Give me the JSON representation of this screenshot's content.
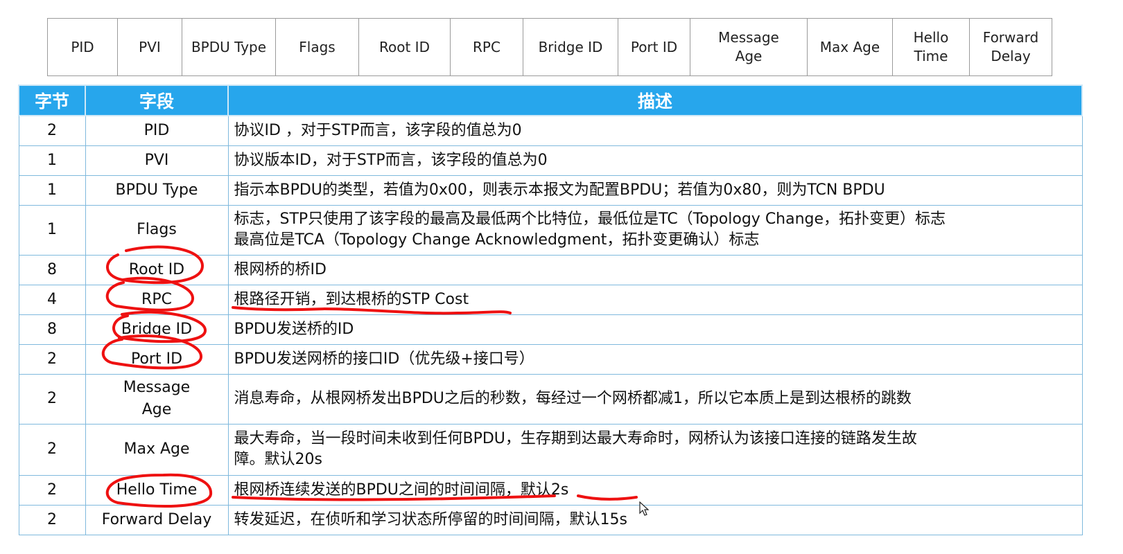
{
  "frame_fields": [
    {
      "label": "PID"
    },
    {
      "label": "PVI"
    },
    {
      "label": "BPDU Type"
    },
    {
      "label": "Flags"
    },
    {
      "label": "Root ID"
    },
    {
      "label": "RPC"
    },
    {
      "label": "Bridge ID"
    },
    {
      "label": "Port ID"
    },
    {
      "label": "Message\nAge"
    },
    {
      "label": "Max Age"
    },
    {
      "label": "Hello\nTime"
    },
    {
      "label": "Forward\nDelay"
    }
  ],
  "table": {
    "headers": {
      "byte": "字节",
      "field": "字段",
      "desc": "描述"
    },
    "rows": [
      {
        "byte": "2",
        "field": "PID",
        "desc": "协议ID ，对于STP而言，该字段的值总为0"
      },
      {
        "byte": "1",
        "field": "PVI",
        "desc": "协议版本ID，对于STP而言，该字段的值总为0"
      },
      {
        "byte": "1",
        "field": "BPDU Type",
        "desc": "指示本BPDU的类型，若值为0x00，则表示本报文为配置BPDU；若值为0x80，则为TCN BPDU"
      },
      {
        "byte": "1",
        "field": "Flags",
        "desc": "标志，STP只使用了该字段的最高及最低两个比特位，最低位是TC（Topology  Change，拓扑变更）标志\n最高位是TCA（Topology Change Acknowledgment，拓扑变更确认）标志"
      },
      {
        "byte": "8",
        "field": "Root ID",
        "desc": "根网桥的桥ID"
      },
      {
        "byte": "4",
        "field": "RPC",
        "desc": "根路径开销，到达根桥的STP Cost"
      },
      {
        "byte": "8",
        "field": "Bridge ID",
        "desc": "BPDU发送桥的ID"
      },
      {
        "byte": "2",
        "field": "Port ID",
        "desc": "BPDU发送网桥的接口ID（优先级+接口号）"
      },
      {
        "byte": "2",
        "field": "Message\nAge",
        "desc": "消息寿命，从根网桥发出BPDU之后的秒数，每经过一个网桥都减1，所以它本质上是到达根桥的跳数"
      },
      {
        "byte": "2",
        "field": "Max Age",
        "desc": "最大寿命，当一段时间未收到任何BPDU，生存期到达最大寿命时，网桥认为该接口连接的链路发生故\n障。默认20s"
      },
      {
        "byte": "2",
        "field": "Hello Time",
        "desc": "根网桥连续发送的BPDU之间的时间间隔，默认2s"
      },
      {
        "byte": "2",
        "field": "Forward Delay",
        "desc": "转发延迟，在侦听和学习状态所停留的时间间隔，默认15s"
      }
    ]
  },
  "colors": {
    "header_bg": "#27a6ec",
    "annotation": "#ee1111",
    "cell_border": "#7fb9dd"
  },
  "icons": {
    "cursor": "mouse-pointer-icon"
  }
}
